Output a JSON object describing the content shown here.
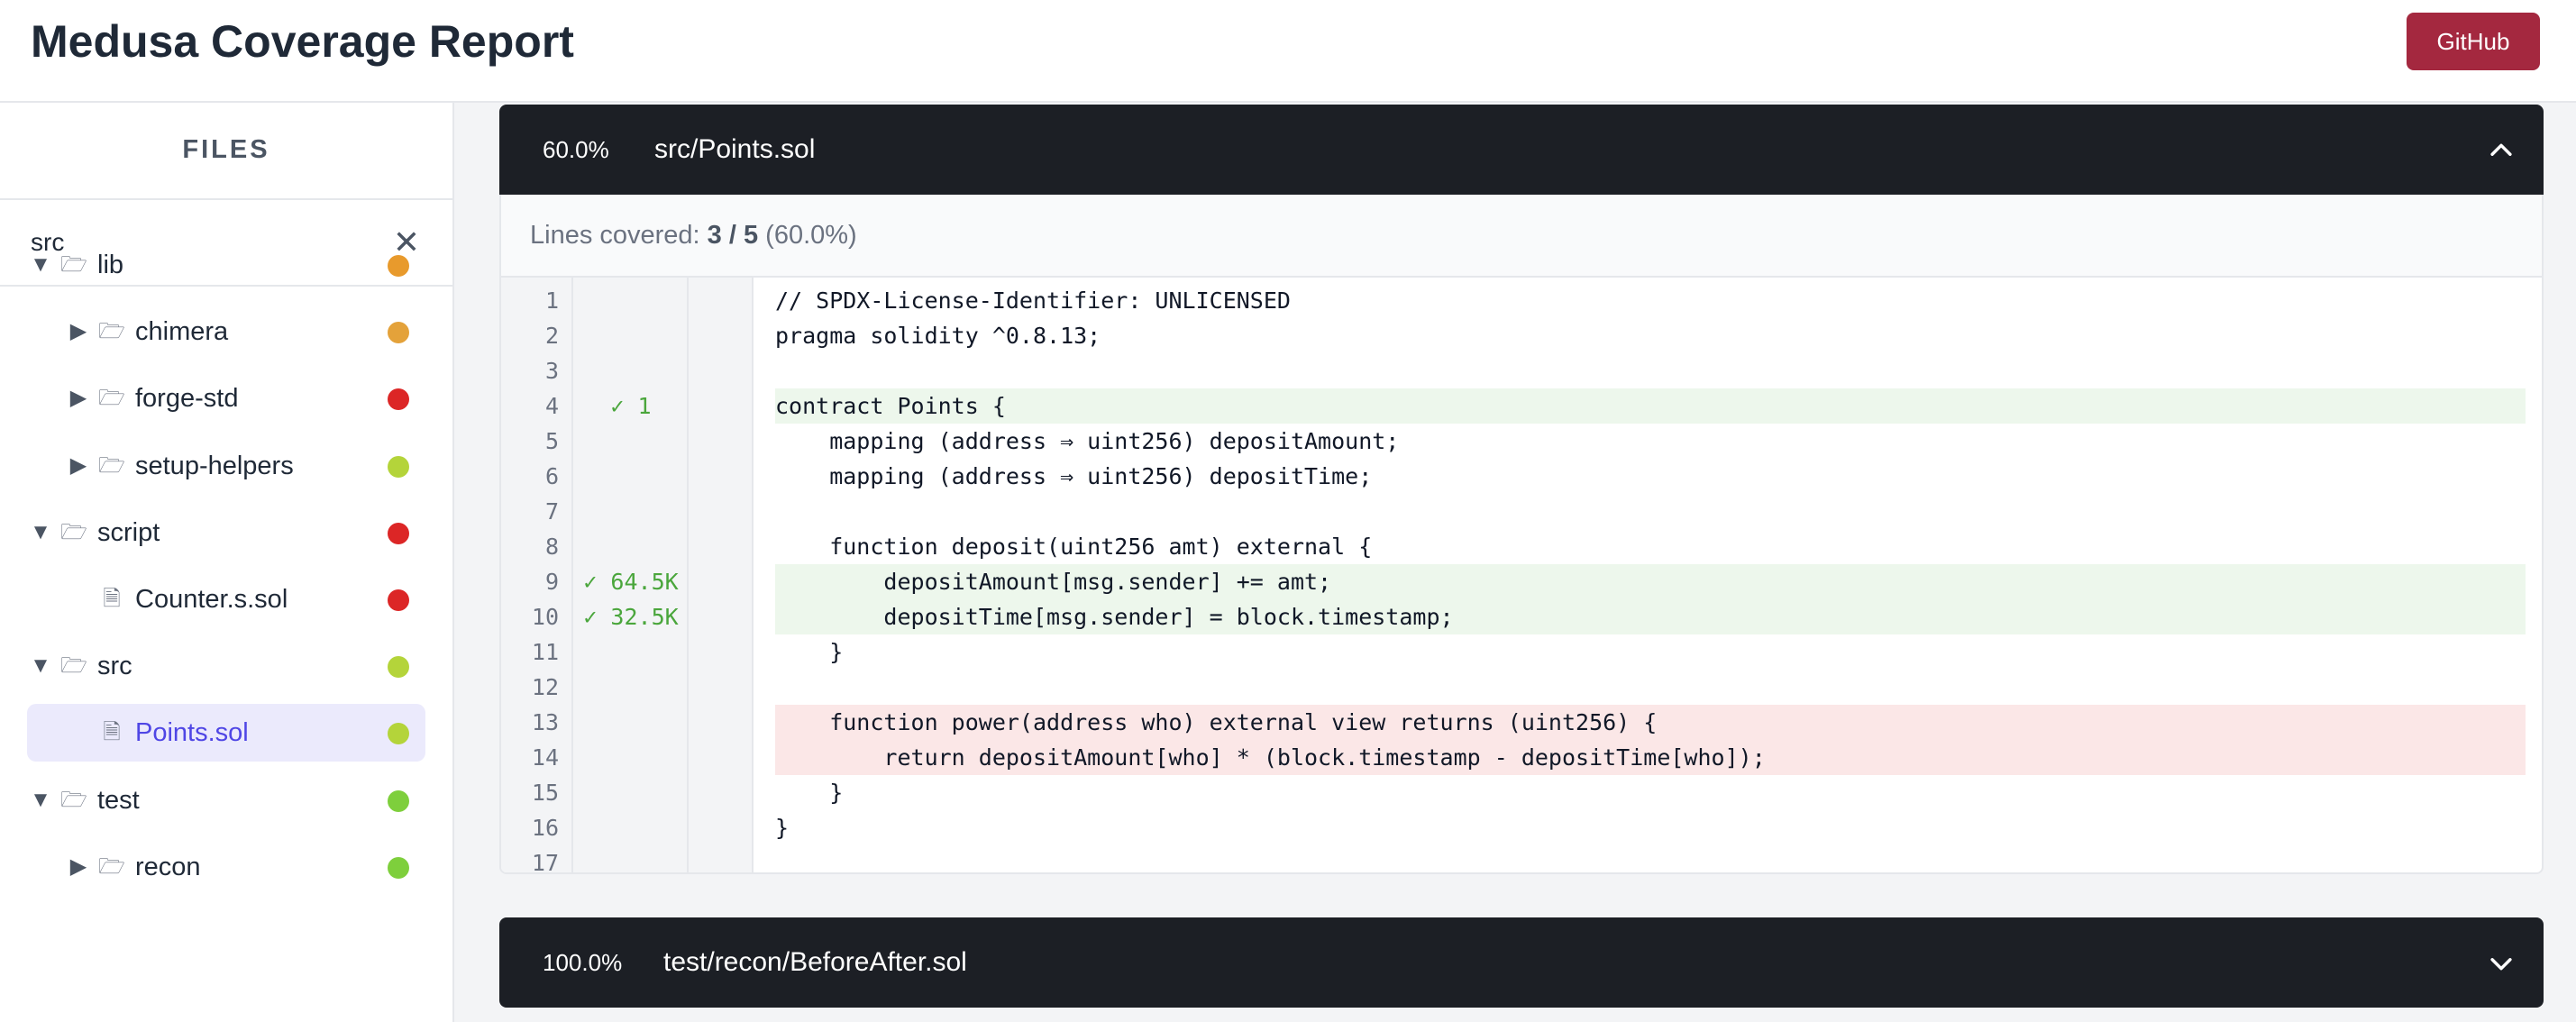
{
  "header": {
    "title": "Medusa Coverage Report",
    "github_label": "GitHub"
  },
  "sidebar": {
    "heading": "FILES",
    "search": {
      "value": "src",
      "placeholder": ""
    },
    "clear_icon": "close-icon",
    "tree": [
      {
        "label": "lib",
        "type": "folder",
        "expanded": true,
        "status_color": "#e89a2c"
      },
      {
        "label": "chimera",
        "type": "folder",
        "expanded": false,
        "status_color": "#e4a23a"
      },
      {
        "label": "forge-std",
        "type": "folder",
        "expanded": false,
        "status_color": "#dc2626"
      },
      {
        "label": "setup-helpers",
        "type": "folder",
        "expanded": false,
        "status_color": "#b4d43a"
      },
      {
        "label": "script",
        "type": "folder",
        "expanded": true,
        "status_color": "#dc2626"
      },
      {
        "label": "Counter.s.sol",
        "type": "file",
        "status_color": "#dc2626"
      },
      {
        "label": "src",
        "type": "folder",
        "expanded": true,
        "status_color": "#b4d43a"
      },
      {
        "label": "Points.sol",
        "type": "file",
        "selected": true,
        "status_color": "#b4d43a"
      },
      {
        "label": "test",
        "type": "folder",
        "expanded": true,
        "status_color": "#7ecf3c"
      },
      {
        "label": "recon",
        "type": "folder",
        "expanded": false,
        "status_color": "#7ecf3c"
      }
    ]
  },
  "panels": [
    {
      "percent": "60.0%",
      "path": "src/Points.sol",
      "expanded": true,
      "summary": {
        "prefix": "Lines covered: ",
        "covered": "3 / 5",
        "suffix": " (60.0%)"
      },
      "lines": [
        {
          "n": "1",
          "hits": "",
          "status": "none",
          "code": "// SPDX-License-Identifier: UNLICENSED"
        },
        {
          "n": "2",
          "hits": "",
          "status": "none",
          "code": "pragma solidity ^0.8.13;"
        },
        {
          "n": "3",
          "hits": "",
          "status": "none",
          "code": ""
        },
        {
          "n": "4",
          "hits": "✓ 1",
          "status": "covered",
          "code": "contract Points {"
        },
        {
          "n": "5",
          "hits": "",
          "status": "none",
          "code": "    mapping (address ⇒ uint256) depositAmount;"
        },
        {
          "n": "6",
          "hits": "",
          "status": "none",
          "code": "    mapping (address ⇒ uint256) depositTime;"
        },
        {
          "n": "7",
          "hits": "",
          "status": "none",
          "code": ""
        },
        {
          "n": "8",
          "hits": "",
          "status": "none",
          "code": "    function deposit(uint256 amt) external {"
        },
        {
          "n": "9",
          "hits": "✓ 64.5K",
          "status": "covered",
          "code": "        depositAmount[msg.sender] += amt;"
        },
        {
          "n": "10",
          "hits": "✓ 32.5K",
          "status": "covered",
          "code": "        depositTime[msg.sender] = block.timestamp;"
        },
        {
          "n": "11",
          "hits": "",
          "status": "none",
          "code": "    }"
        },
        {
          "n": "12",
          "hits": "",
          "status": "none",
          "code": ""
        },
        {
          "n": "13",
          "hits": "",
          "status": "uncovered",
          "code": "    function power(address who) external view returns (uint256) {"
        },
        {
          "n": "14",
          "hits": "",
          "status": "uncovered",
          "code": "        return depositAmount[who] * (block.timestamp - depositTime[who]);"
        },
        {
          "n": "15",
          "hits": "",
          "status": "none",
          "code": "    }"
        },
        {
          "n": "16",
          "hits": "",
          "status": "none",
          "code": "}"
        },
        {
          "n": "17",
          "hits": "",
          "status": "none",
          "code": ""
        }
      ]
    },
    {
      "percent": "100.0%",
      "path": "test/recon/BeforeAfter.sol",
      "expanded": false
    }
  ],
  "icons": {
    "folder": "folder-icon",
    "file": "file-icon",
    "expanded_arrow": "caret-down-icon",
    "collapsed_arrow": "caret-right-icon",
    "panel_expanded": "chevron-up-icon",
    "panel_collapsed": "chevron-down-icon"
  }
}
